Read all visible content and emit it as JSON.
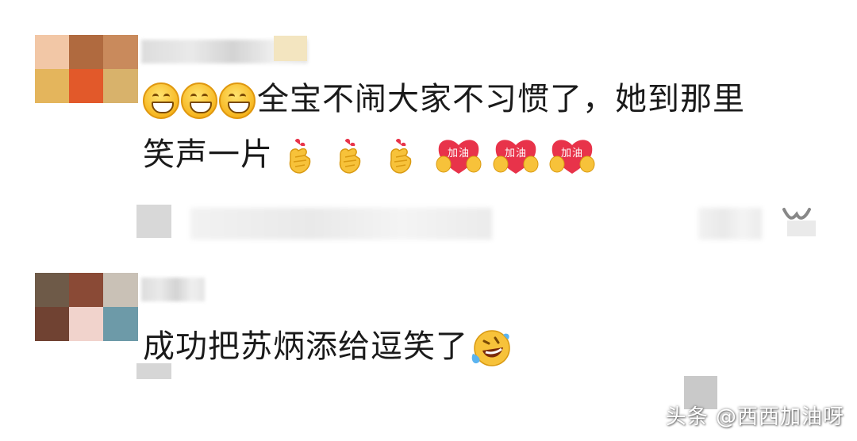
{
  "comments": [
    {
      "text_line1": "全宝不闹大家不习惯了，她到那里",
      "text_line2": "笑声一片",
      "cheer_label": "加油",
      "emojis_line1": [
        "grin-emoji",
        "grin-emoji",
        "grin-emoji"
      ],
      "emojis_line2": [
        "finger-heart-emoji",
        "finger-heart-emoji",
        "finger-heart-emoji",
        "cheer-heart-emoji",
        "cheer-heart-emoji",
        "cheer-heart-emoji"
      ]
    },
    {
      "text_line1": "成功把苏炳添给逗笑了",
      "emojis_line1": [
        "laughing-tears-emoji"
      ]
    }
  ],
  "watermark": "头条 @西西加油呀",
  "colors": {
    "background": "#ffffff",
    "text": "#1a1a1a",
    "emoji_yellow": "#f6b41c",
    "heart_red": "#e8334a"
  }
}
